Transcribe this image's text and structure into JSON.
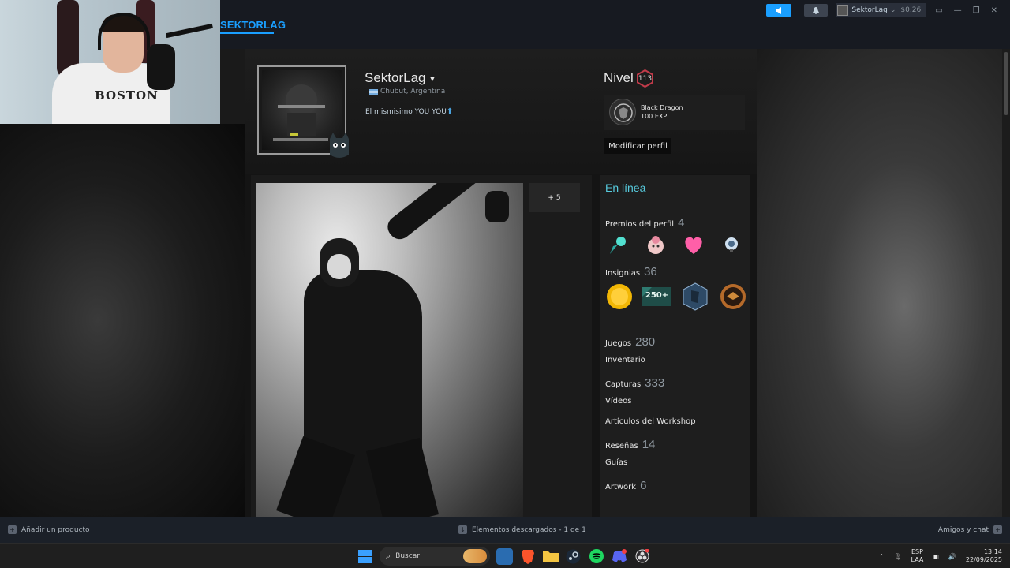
{
  "topbar": {
    "title": "SEKTORLAG",
    "user_name": "SektorLag",
    "user_caret": "⌄",
    "balance": "$0.26"
  },
  "webcam": {
    "shirt_text": "BOSTON"
  },
  "profile": {
    "name": "SektorLag",
    "location": "Chubut, Argentina",
    "summary": "El mismisimo YOU YOU",
    "level_label": "Nivel",
    "level": "113",
    "favorite_badge_name": "Black Dragon",
    "favorite_badge_xp": "100 EXP",
    "edit_button": "Modificar perfil"
  },
  "showcase": {
    "more_label": "+ 5"
  },
  "sidebar": {
    "status": "En línea",
    "awards_label": "Premios del perfil",
    "awards_count": "4",
    "badges_label": "Insignias",
    "badges_count": "36",
    "badge_250_text": "250+",
    "links": [
      {
        "label": "Juegos",
        "count": "280"
      },
      {
        "label": "Inventario",
        "count": ""
      },
      {
        "label": "Capturas",
        "count": "333"
      },
      {
        "label": "Vídeos",
        "count": ""
      },
      {
        "label": "Artículos del Workshop",
        "count": ""
      },
      {
        "label": "Reseñas",
        "count": "14"
      },
      {
        "label": "Guías",
        "count": ""
      },
      {
        "label": "Artwork",
        "count": "6"
      }
    ]
  },
  "footer": {
    "add_product": "Añadir un producto",
    "downloads": "Elementos descargados - 1 de 1",
    "friends": "Amigos y chat"
  },
  "taskbar": {
    "search_placeholder": "Buscar",
    "lang_top": "ESP",
    "lang_bottom": "LAA",
    "time": "13:14",
    "date": "22/09/2025"
  },
  "colors": {
    "accent": "#1a9fff",
    "online": "#57cbde"
  }
}
